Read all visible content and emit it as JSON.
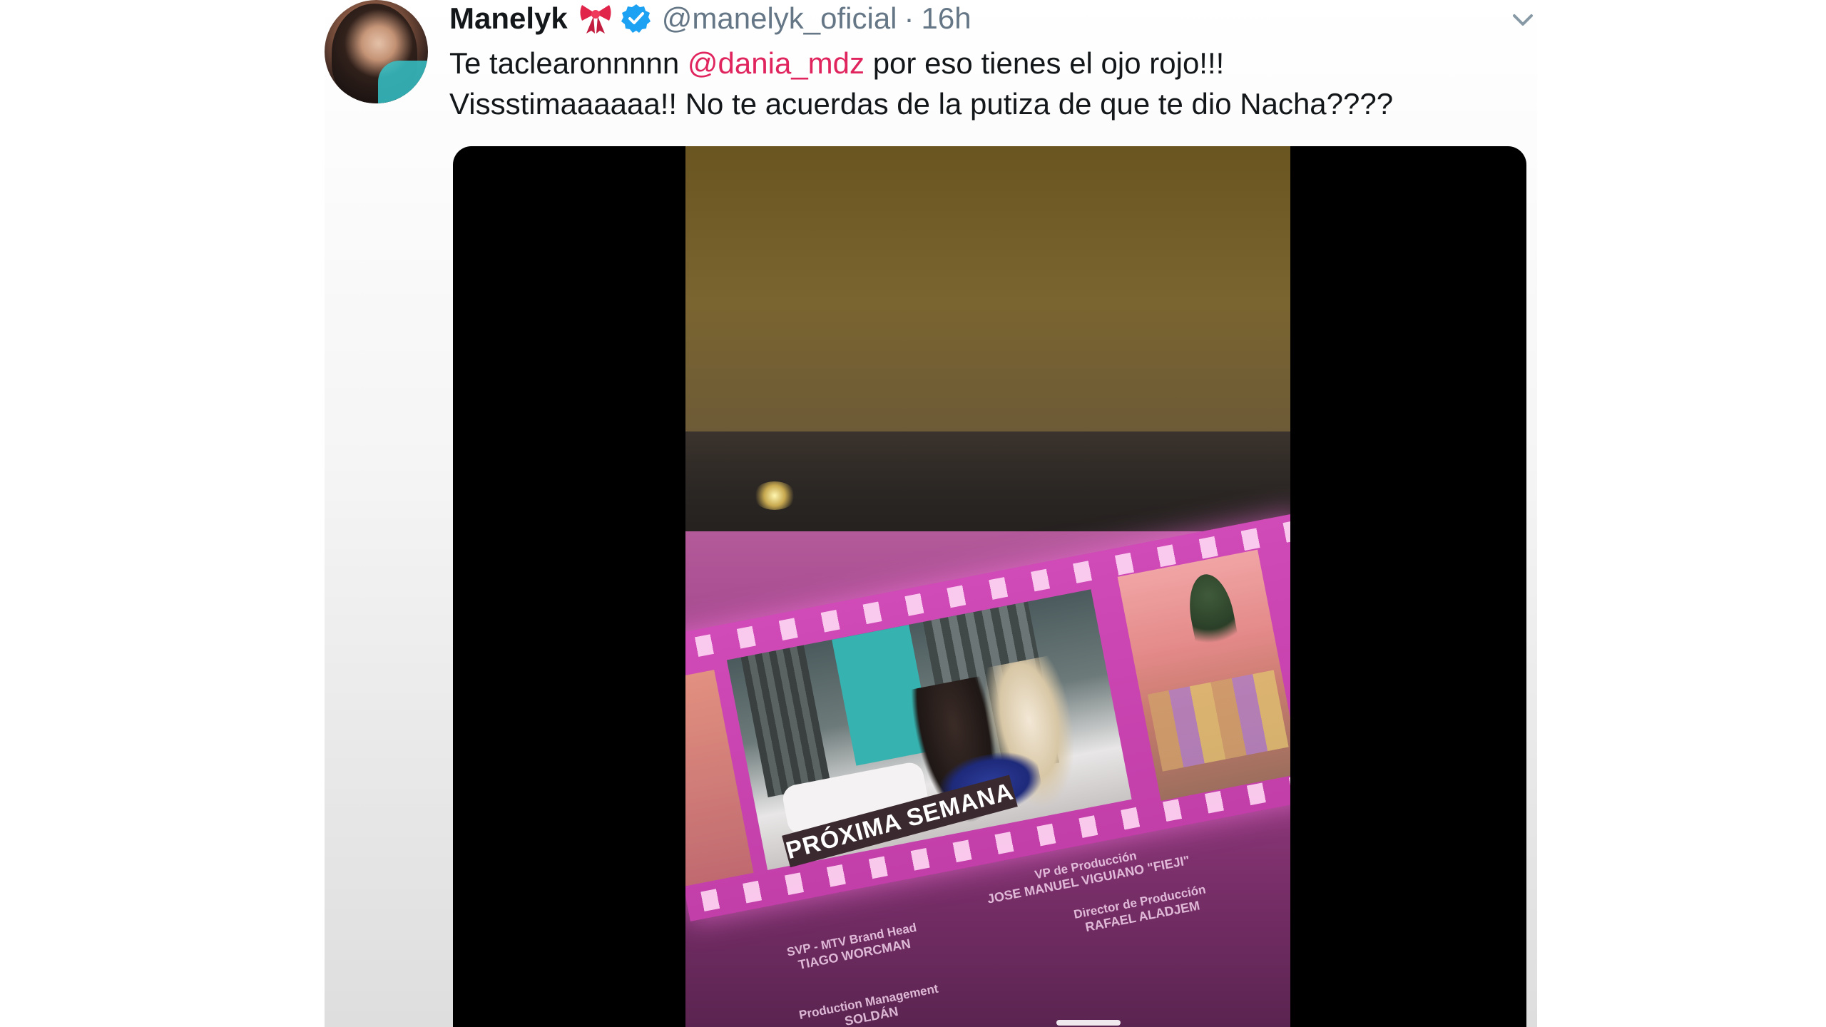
{
  "tweet": {
    "display_name": "Manelyk",
    "handle": "@manelyk_oficial",
    "separator": "·",
    "time": "16h",
    "text_before_mention": "Te taclearonnnnn ",
    "mention": "@dania_mdz",
    "text_after_mention": " por eso tienes el ojo rojo!!!",
    "text_line2": "Vissstimaaaaaa!! No te acuerdas de la putiza de que te dio Nacha????"
  },
  "icons": {
    "bow": "bow-emoji-icon",
    "verified": "verified-badge-icon",
    "menu": "chevron-down-icon"
  },
  "colors": {
    "mention": "#e0245e",
    "verified": "#1da1f2",
    "secondary_text": "#657786"
  },
  "video": {
    "banner": "PRÓXIMA SEMANA",
    "credits": [
      {
        "role": "SVP - MTV Brand Head",
        "name": "TIAGO WORCMAN"
      },
      {
        "role": "VP de Producción",
        "name": "JOSE MANUEL VIGUIANO \"FIEJI\""
      },
      {
        "role": "Director de Producción",
        "name": "RAFAEL ALADJEM"
      },
      {
        "role": "Production Management",
        "name": "SOLDÁN"
      }
    ]
  }
}
